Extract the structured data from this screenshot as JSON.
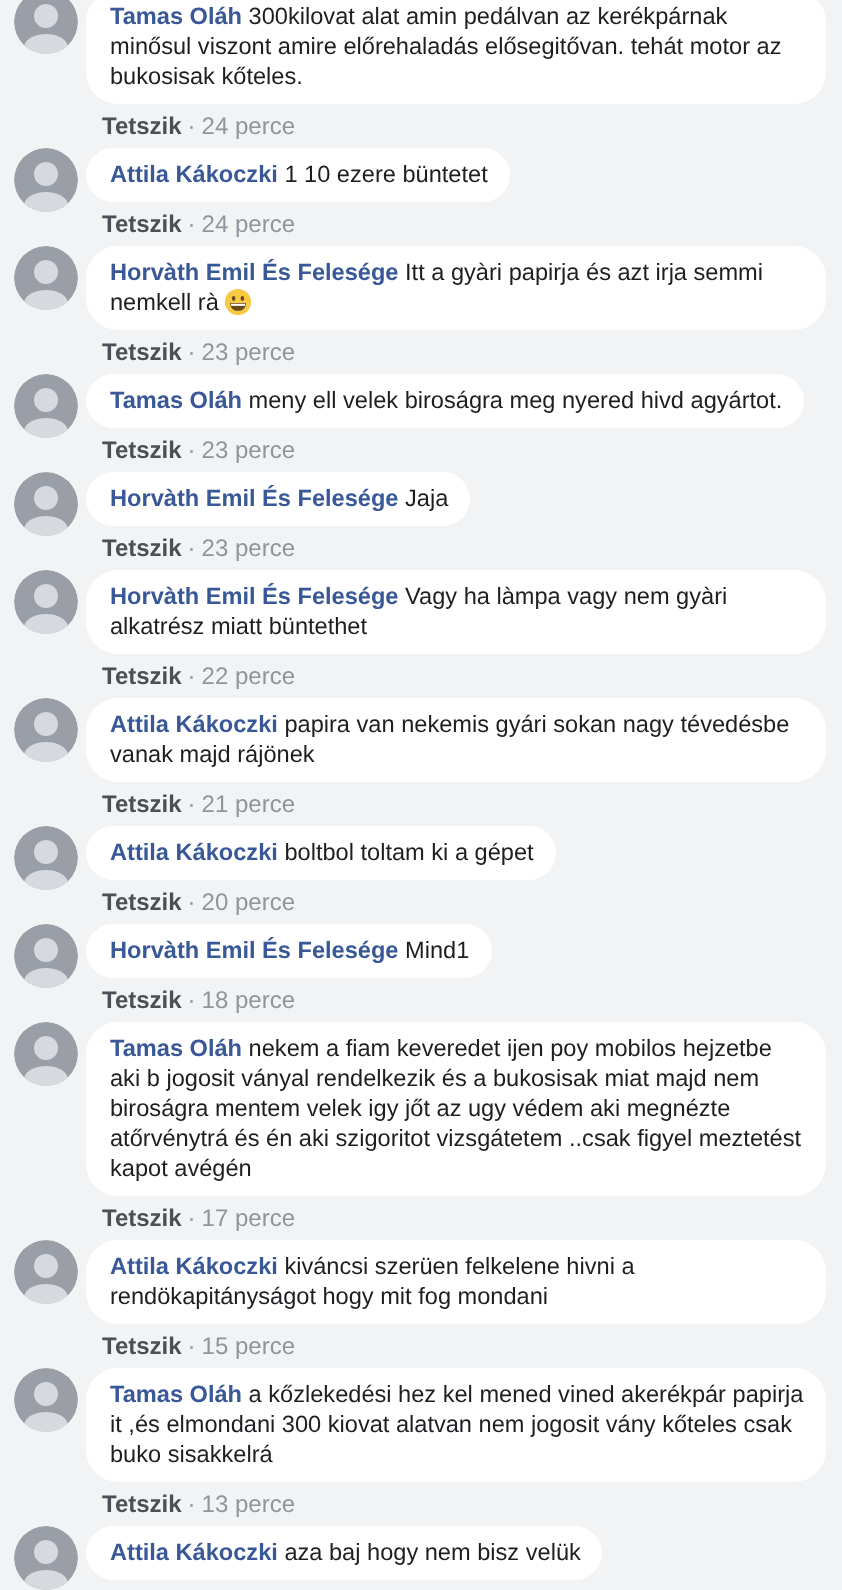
{
  "separator": "·",
  "comments": [
    {
      "author": "Tamas Oláh",
      "text": "300kilovat alat amin pedálvan az kerékpárnak minősul viszont amire előrehaladás elősegitővan. tehát motor az bukosisak kőteles.",
      "emoji": false,
      "like": "Tetszik",
      "time": "24 perce"
    },
    {
      "author": "Attila Kákoczki",
      "text": "1 10 ezere büntetet",
      "emoji": false,
      "like": "Tetszik",
      "time": "24 perce"
    },
    {
      "author": "Horvàth Emil És Felesége",
      "text": "Itt a gyàri papirja és azt irja semmi nemkell rà",
      "emoji": true,
      "like": "Tetszik",
      "time": "23 perce"
    },
    {
      "author": "Tamas Oláh",
      "text": "meny ell velek biroságra meg nyered hivd agyártot.",
      "emoji": false,
      "like": "Tetszik",
      "time": "23 perce"
    },
    {
      "author": "Horvàth Emil És Felesége",
      "text": "Jaja",
      "emoji": false,
      "like": "Tetszik",
      "time": "23 perce"
    },
    {
      "author": "Horvàth Emil És Felesége",
      "text": "Vagy ha làmpa vagy nem gyàri alkatrész miatt büntethet",
      "emoji": false,
      "like": "Tetszik",
      "time": "22 perce"
    },
    {
      "author": "Attila Kákoczki",
      "text": "papira van nekemis gyári sokan nagy tévedésbe vanak majd rájönek",
      "emoji": false,
      "like": "Tetszik",
      "time": "21 perce"
    },
    {
      "author": "Attila Kákoczki",
      "text": "boltbol toltam ki a gépet",
      "emoji": false,
      "like": "Tetszik",
      "time": "20 perce"
    },
    {
      "author": "Horvàth Emil És Felesége",
      "text": "Mind1",
      "emoji": false,
      "like": "Tetszik",
      "time": "18 perce"
    },
    {
      "author": "Tamas Oláh",
      "text": "nekem a fiam keveredet ijen poy mobilos hejzetbe aki b jogosit ványal rendelkezik és a bukosisak miat majd nem biroságra mentem velek igy jőt az ugy védem aki megnézte atőrvénytrá és én aki szigoritot vizsgátetem ..csak figyel meztetést kapot avégén",
      "emoji": false,
      "like": "Tetszik",
      "time": "17 perce"
    },
    {
      "author": "Attila Kákoczki",
      "text": "kiváncsi szerüen felkelene hivni a rendökapitányságot hogy mit fog mondani",
      "emoji": false,
      "like": "Tetszik",
      "time": "15 perce"
    },
    {
      "author": "Tamas Oláh",
      "text": "a kőzlekedési hez kel mened vined akerékpár papirja it ,és elmondani 300 kiovat alatvan nem jogosit vány kőteles csak buko sisakkelrá",
      "emoji": false,
      "like": "Tetszik",
      "time": "13 perce"
    },
    {
      "author": "Attila Kákoczki",
      "text": "aza baj hogy nem bisz velük",
      "emoji": false
    }
  ]
}
